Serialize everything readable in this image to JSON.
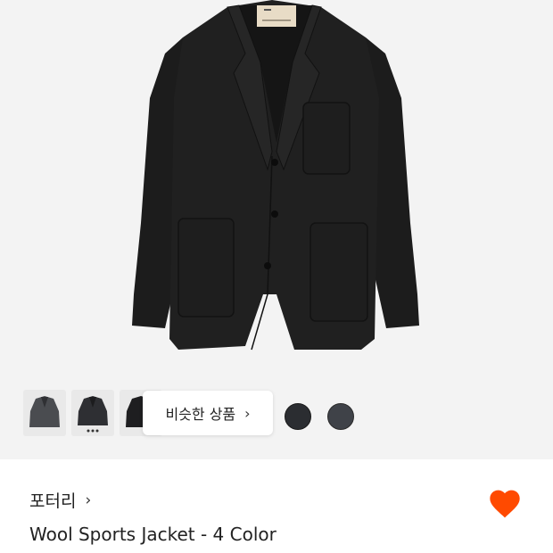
{
  "gallery": {
    "main_image": "black-wool-jacket-photo",
    "thumbnails": [
      "charcoal-jacket-thumb",
      "dark-grey-jacket-thumb",
      "black-jacket-thumb"
    ],
    "similar_products_label": "비슷한 상품",
    "similar_products_icon": "chevron-right-icon",
    "color_swatches": [
      "#2b2d31",
      "#3f4248"
    ]
  },
  "product": {
    "brand": "포터리",
    "brand_icon": "chevron-right-icon",
    "title": "Wool Sports Jacket - 4 Color",
    "favorite_icon": "heart-icon",
    "favorite_color": "#ff4a00"
  }
}
